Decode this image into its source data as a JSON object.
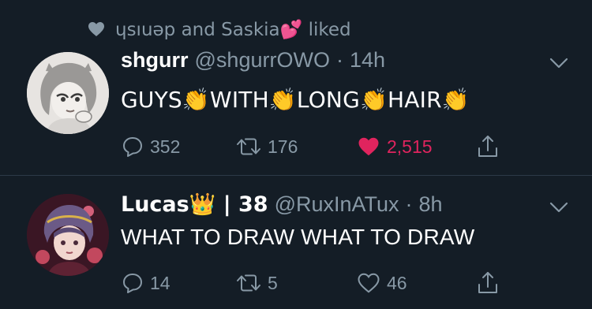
{
  "social_context": {
    "text": "ɥsıuǝp and Saskia💕 liked"
  },
  "tweets": [
    {
      "display_name": "shgurr",
      "handle": "@shgurrOWO",
      "separator": "·",
      "time": "14h",
      "text": "GUYS👏WITH👏LONG👏HAIR👏",
      "replies": "352",
      "retweets": "176",
      "likes": "2,515",
      "liked": true
    },
    {
      "display_name": "Lucas👑 | 38",
      "handle": "@RuxInATux",
      "separator": "·",
      "time": "8h",
      "text": "WHAT TO DRAW WHAT TO DRAW",
      "replies": "14",
      "retweets": "5",
      "likes": "46",
      "liked": false
    }
  ],
  "colors": {
    "background": "#141d26",
    "secondary_text": "#8899a6",
    "like_active": "#e0245e",
    "divider": "#2c3a48"
  },
  "icons": {
    "social": "heart-icon",
    "menu": "chevron-down-icon",
    "reply": "reply-icon",
    "retweet": "retweet-icon",
    "like": "heart-icon",
    "share": "share-icon"
  }
}
